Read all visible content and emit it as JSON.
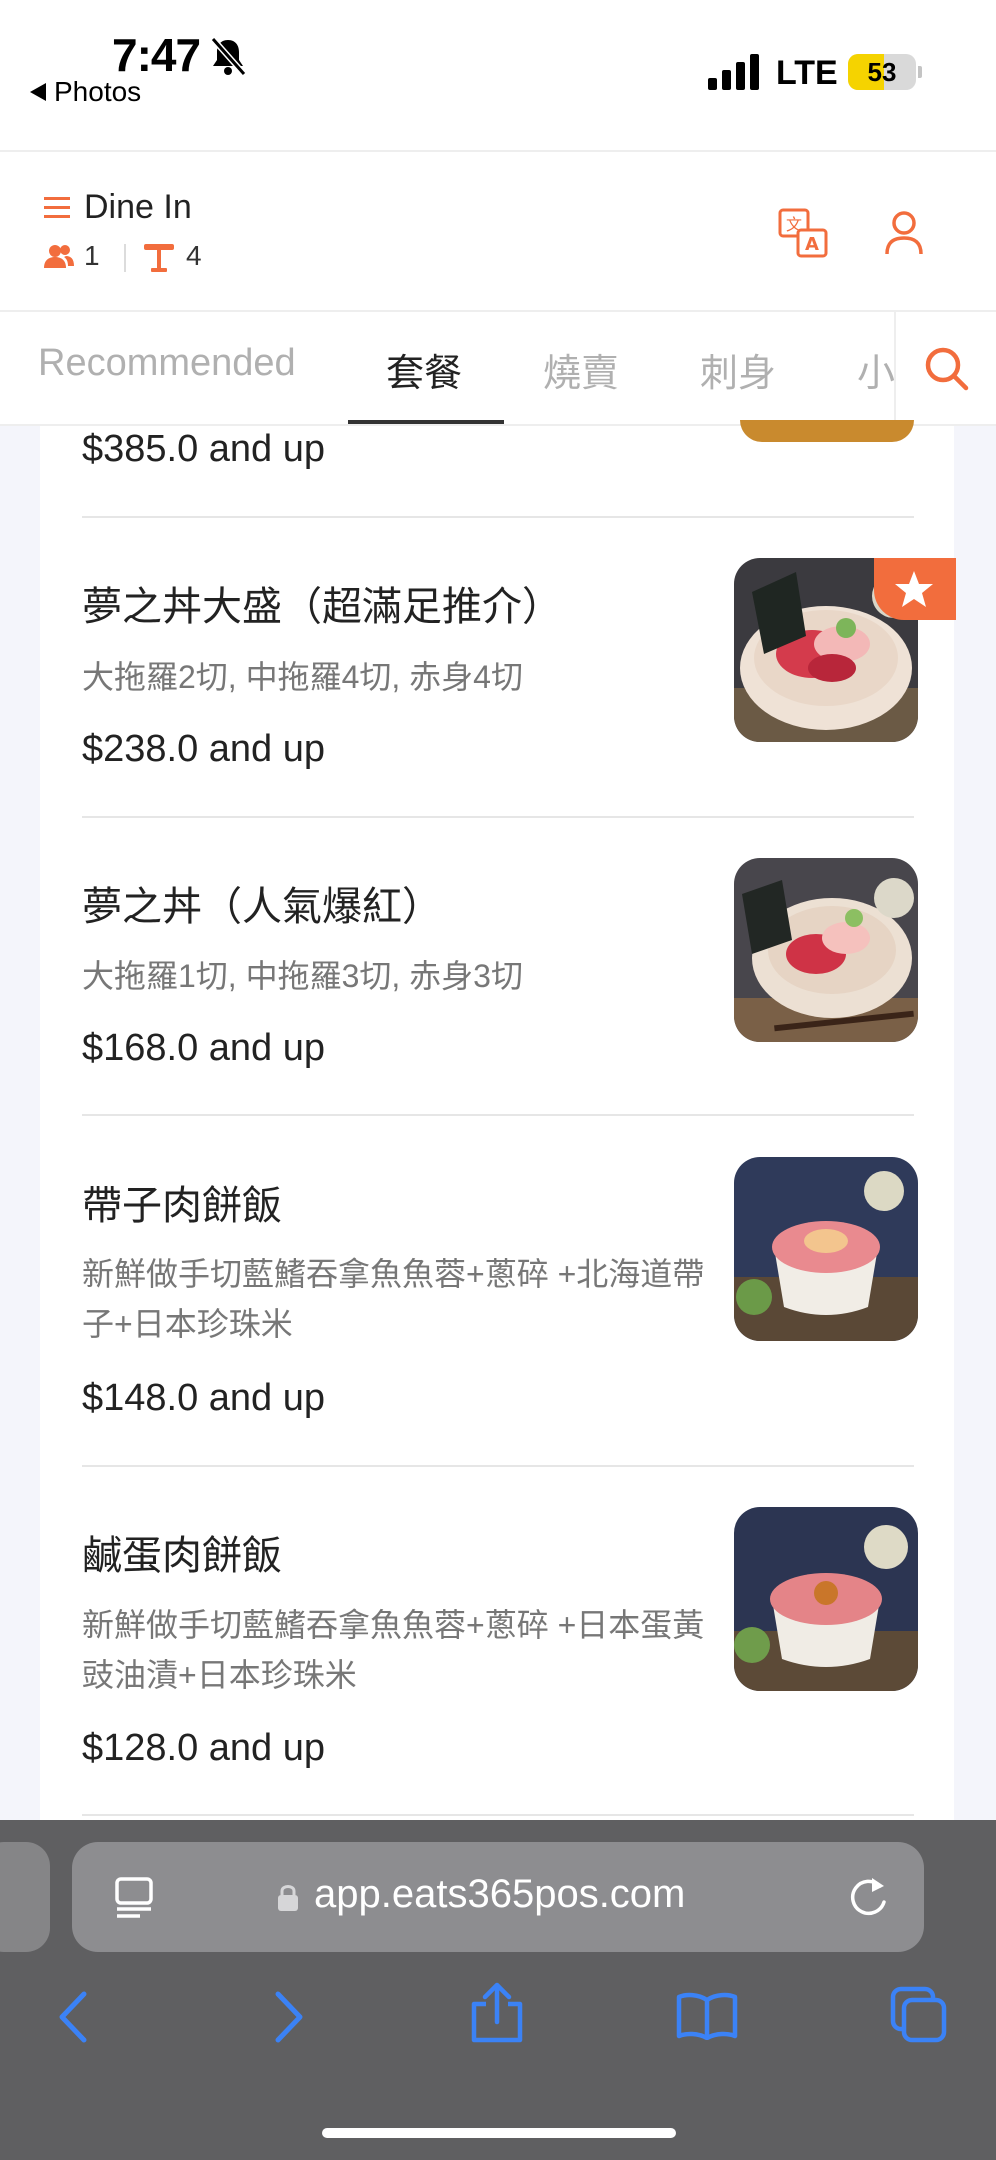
{
  "status_bar": {
    "time": "7:47",
    "back_label": "Photos",
    "network": "LTE",
    "battery_level": "53",
    "battery_fraction": 0.53
  },
  "header": {
    "mode_label": "Dine In",
    "guests": "1",
    "table": "4"
  },
  "tabs": [
    "Recommended",
    "套餐",
    "燒賣",
    "刺身",
    "小"
  ],
  "active_tab": "套餐",
  "menu": {
    "partial_item_price": "$385.0 and up",
    "items": [
      {
        "title": "夢之丼大盛（超滿足推介）",
        "description": "大拖羅2切, 中拖羅4切, 赤身4切",
        "price": "$238.0 and up",
        "featured": true
      },
      {
        "title": "夢之丼（人氣爆紅）",
        "description": "大拖羅1切, 中拖羅3切, 赤身3切",
        "price": "$168.0 and up",
        "featured": false
      },
      {
        "title": "帶子肉餅飯",
        "description": "新鮮做手切藍鰭吞拿魚魚蓉+蔥碎 +北海道帶子+日本珍珠米",
        "price": "$148.0 and up",
        "featured": false
      },
      {
        "title": "鹹蛋肉餅飯",
        "description": "新鮮做手切藍鰭吞拿魚魚蓉+蔥碎 +日本蛋黃豉油漬+日本珍珠米",
        "price": "$128.0 and up",
        "featured": false
      }
    ]
  },
  "browser": {
    "url": "app.eats365pos.com"
  },
  "colors": {
    "accent": "#f26d3d",
    "browser_blue": "#3b82f6",
    "browser_bar": "#5f5f61"
  },
  "icons": [
    "bell-slash-icon",
    "signal-icon",
    "menu-icon",
    "guests-icon",
    "table-icon",
    "translate-icon",
    "user-icon",
    "search-icon",
    "star-icon",
    "reader-icon",
    "lock-icon",
    "reload-icon",
    "back-icon",
    "forward-icon",
    "share-icon",
    "bookmarks-icon",
    "tabs-icon"
  ]
}
